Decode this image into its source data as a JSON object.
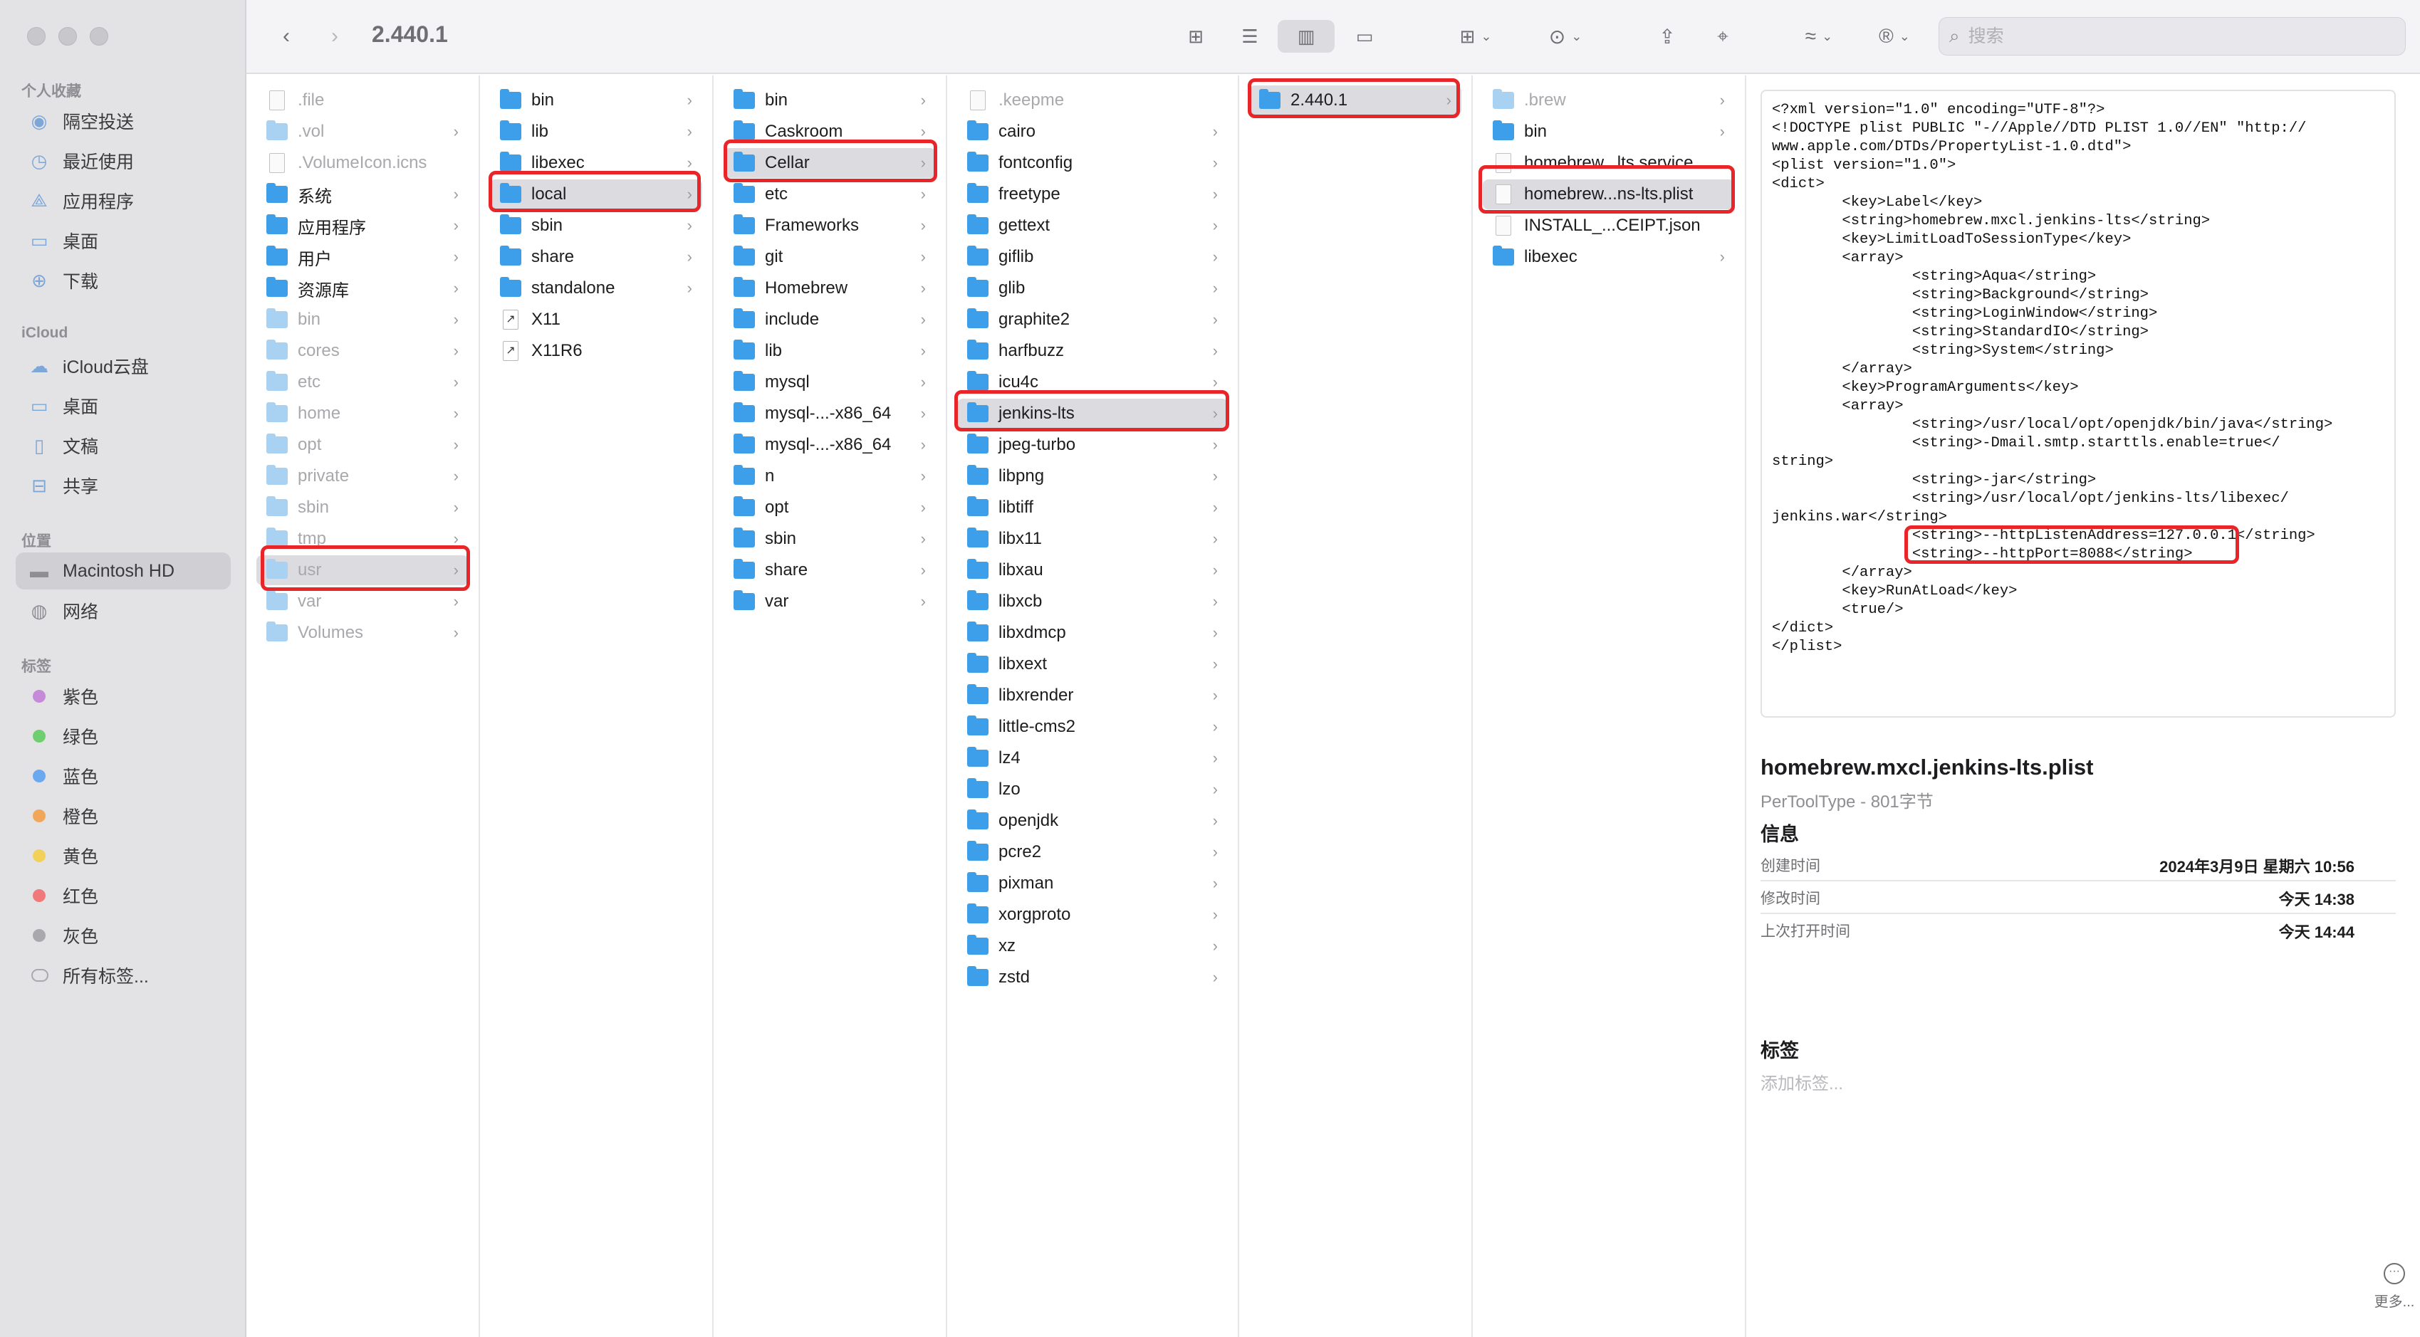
{
  "window": {
    "title": "2.440.1"
  },
  "toolbar": {
    "back_icon": "chevron-left-icon",
    "forward_icon": "chevron-right-icon",
    "search_placeholder": "搜索"
  },
  "sidebar": {
    "sections": {
      "favorites": "个人收藏",
      "icloud": "iCloud",
      "locations": "位置",
      "tags": "标签"
    },
    "favorites": [
      "隔空投送",
      "最近使用",
      "应用程序",
      "桌面",
      "下载"
    ],
    "icloud": [
      "iCloud云盘",
      "桌面",
      "文稿",
      "共享"
    ],
    "locations": [
      "Macintosh HD",
      "网络"
    ],
    "tags": [
      {
        "label": "紫色",
        "color": "#c58ad8"
      },
      {
        "label": "绿色",
        "color": "#6fcf6f"
      },
      {
        "label": "蓝色",
        "color": "#6aa8f0"
      },
      {
        "label": "橙色",
        "color": "#f2a65a"
      },
      {
        "label": "黄色",
        "color": "#f2d15a"
      },
      {
        "label": "红色",
        "color": "#f07a7a"
      },
      {
        "label": "灰色",
        "color": "#a8a8ad"
      },
      {
        "label": "所有标签...",
        "color": ""
      }
    ]
  },
  "columns": [
    [
      {
        "name": ".file",
        "kind": "file",
        "dim": true,
        "chev": false
      },
      {
        "name": ".vol",
        "kind": "folder",
        "dim": true,
        "chev": true
      },
      {
        "name": ".VolumeIcon.icns",
        "kind": "file",
        "dim": true,
        "chev": false
      },
      {
        "name": "系统",
        "kind": "folder",
        "dim": false,
        "chev": true
      },
      {
        "name": "应用程序",
        "kind": "folder",
        "dim": false,
        "chev": true
      },
      {
        "name": "用户",
        "kind": "folder",
        "dim": false,
        "chev": true
      },
      {
        "name": "资源库",
        "kind": "folder",
        "dim": false,
        "chev": true
      },
      {
        "name": "bin",
        "kind": "folder",
        "dim": true,
        "chev": true
      },
      {
        "name": "cores",
        "kind": "folder",
        "dim": true,
        "chev": true
      },
      {
        "name": "etc",
        "kind": "folder",
        "dim": true,
        "chev": true
      },
      {
        "name": "home",
        "kind": "folder",
        "dim": true,
        "chev": true
      },
      {
        "name": "opt",
        "kind": "folder",
        "dim": true,
        "chev": true
      },
      {
        "name": "private",
        "kind": "folder",
        "dim": true,
        "chev": true
      },
      {
        "name": "sbin",
        "kind": "folder",
        "dim": true,
        "chev": true
      },
      {
        "name": "tmp",
        "kind": "folder",
        "dim": true,
        "chev": true
      },
      {
        "name": "usr",
        "kind": "folder",
        "dim": true,
        "chev": true,
        "selected": true
      },
      {
        "name": "var",
        "kind": "folder",
        "dim": true,
        "chev": true
      },
      {
        "name": "Volumes",
        "kind": "folder",
        "dim": true,
        "chev": true
      }
    ],
    [
      {
        "name": "bin",
        "kind": "folder",
        "chev": true
      },
      {
        "name": "lib",
        "kind": "folder",
        "chev": true
      },
      {
        "name": "libexec",
        "kind": "folder",
        "chev": true
      },
      {
        "name": "local",
        "kind": "folder",
        "chev": true,
        "selected": true
      },
      {
        "name": "sbin",
        "kind": "folder",
        "chev": true
      },
      {
        "name": "share",
        "kind": "folder",
        "chev": true
      },
      {
        "name": "standalone",
        "kind": "folder",
        "chev": true
      },
      {
        "name": "X11",
        "kind": "alias",
        "chev": false
      },
      {
        "name": "X11R6",
        "kind": "alias",
        "chev": false
      }
    ],
    [
      {
        "name": "bin",
        "kind": "folder",
        "chev": true
      },
      {
        "name": "Caskroom",
        "kind": "folder",
        "chev": true
      },
      {
        "name": "Cellar",
        "kind": "folder",
        "chev": true,
        "selected": true
      },
      {
        "name": "etc",
        "kind": "folder",
        "chev": true
      },
      {
        "name": "Frameworks",
        "kind": "folder",
        "chev": true
      },
      {
        "name": "git",
        "kind": "folder",
        "chev": true
      },
      {
        "name": "Homebrew",
        "kind": "folder",
        "chev": true
      },
      {
        "name": "include",
        "kind": "folder",
        "chev": true
      },
      {
        "name": "lib",
        "kind": "folder",
        "chev": true
      },
      {
        "name": "mysql",
        "kind": "folder",
        "chev": true
      },
      {
        "name": "mysql-...-x86_64",
        "kind": "folder",
        "chev": true
      },
      {
        "name": "mysql-...-x86_64",
        "kind": "folder",
        "chev": true
      },
      {
        "name": "n",
        "kind": "folder",
        "chev": true
      },
      {
        "name": "opt",
        "kind": "folder",
        "chev": true
      },
      {
        "name": "sbin",
        "kind": "folder",
        "chev": true
      },
      {
        "name": "share",
        "kind": "folder",
        "chev": true
      },
      {
        "name": "var",
        "kind": "folder",
        "chev": true
      }
    ],
    [
      {
        "name": ".keepme",
        "kind": "file",
        "dim": true,
        "chev": false
      },
      {
        "name": "cairo",
        "kind": "folder",
        "chev": true
      },
      {
        "name": "fontconfig",
        "kind": "folder",
        "chev": true
      },
      {
        "name": "freetype",
        "kind": "folder",
        "chev": true
      },
      {
        "name": "gettext",
        "kind": "folder",
        "chev": true
      },
      {
        "name": "giflib",
        "kind": "folder",
        "chev": true
      },
      {
        "name": "glib",
        "kind": "folder",
        "chev": true
      },
      {
        "name": "graphite2",
        "kind": "folder",
        "chev": true
      },
      {
        "name": "harfbuzz",
        "kind": "folder",
        "chev": true
      },
      {
        "name": "icu4c",
        "kind": "folder",
        "chev": true
      },
      {
        "name": "jenkins-lts",
        "kind": "folder",
        "chev": true,
        "selected": true
      },
      {
        "name": "jpeg-turbo",
        "kind": "folder",
        "chev": true
      },
      {
        "name": "libpng",
        "kind": "folder",
        "chev": true
      },
      {
        "name": "libtiff",
        "kind": "folder",
        "chev": true
      },
      {
        "name": "libx11",
        "kind": "folder",
        "chev": true
      },
      {
        "name": "libxau",
        "kind": "folder",
        "chev": true
      },
      {
        "name": "libxcb",
        "kind": "folder",
        "chev": true
      },
      {
        "name": "libxdmcp",
        "kind": "folder",
        "chev": true
      },
      {
        "name": "libxext",
        "kind": "folder",
        "chev": true
      },
      {
        "name": "libxrender",
        "kind": "folder",
        "chev": true
      },
      {
        "name": "little-cms2",
        "kind": "folder",
        "chev": true
      },
      {
        "name": "lz4",
        "kind": "folder",
        "chev": true
      },
      {
        "name": "lzo",
        "kind": "folder",
        "chev": true
      },
      {
        "name": "openjdk",
        "kind": "folder",
        "chev": true
      },
      {
        "name": "pcre2",
        "kind": "folder",
        "chev": true
      },
      {
        "name": "pixman",
        "kind": "folder",
        "chev": true
      },
      {
        "name": "xorgproto",
        "kind": "folder",
        "chev": true
      },
      {
        "name": "xz",
        "kind": "folder",
        "chev": true
      },
      {
        "name": "zstd",
        "kind": "folder",
        "chev": true
      }
    ],
    [
      {
        "name": "2.440.1",
        "kind": "folder",
        "chev": true,
        "selected": true
      }
    ],
    [
      {
        "name": ".brew",
        "kind": "folder",
        "dim": true,
        "chev": true
      },
      {
        "name": "bin",
        "kind": "folder",
        "chev": true
      },
      {
        "name": "homebrew...lts.service",
        "kind": "file",
        "chev": false
      },
      {
        "name": "homebrew...ns-lts.plist",
        "kind": "file",
        "chev": false,
        "selected": true
      },
      {
        "name": "INSTALL_...CEIPT.json",
        "kind": "file",
        "chev": false
      },
      {
        "name": "libexec",
        "kind": "folder",
        "chev": true
      }
    ]
  ],
  "preview": {
    "code": "<?xml version=\"1.0\" encoding=\"UTF-8\"?>\n<!DOCTYPE plist PUBLIC \"-//Apple//DTD PLIST 1.0//EN\" \"http://\nwww.apple.com/DTDs/PropertyList-1.0.dtd\">\n<plist version=\"1.0\">\n<dict>\n        <key>Label</key>\n        <string>homebrew.mxcl.jenkins-lts</string>\n        <key>LimitLoadToSessionType</key>\n        <array>\n                <string>Aqua</string>\n                <string>Background</string>\n                <string>LoginWindow</string>\n                <string>StandardIO</string>\n                <string>System</string>\n        </array>\n        <key>ProgramArguments</key>\n        <array>\n                <string>/usr/local/opt/openjdk/bin/java</string>\n                <string>-Dmail.smtp.starttls.enable=true</\nstring>\n                <string>-jar</string>\n                <string>/usr/local/opt/jenkins-lts/libexec/\njenkins.war</string>\n                <string>--httpListenAddress=127.0.0.1</string>\n                <string>--httpPort=8088</string>\n        </array>\n        <key>RunAtLoad</key>\n        <true/>\n</dict>\n</plist>",
    "filename": "homebrew.mxcl.jenkins-lts.plist",
    "type": "PerToolType - 801字节",
    "info_heading": "信息",
    "info": [
      {
        "label": "创建时间",
        "value": "2024年3月9日 星期六 10:56"
      },
      {
        "label": "修改时间",
        "value": "今天 14:38"
      },
      {
        "label": "上次打开时间",
        "value": "今天 14:44"
      }
    ],
    "tags_heading": "标签",
    "add_tag": "添加标签...",
    "more_label": "更多..."
  }
}
